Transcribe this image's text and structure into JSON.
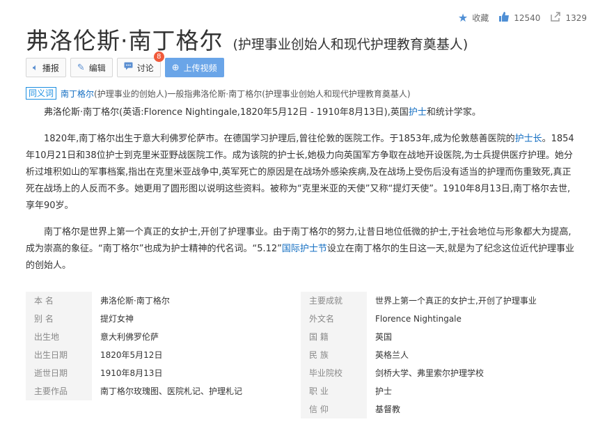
{
  "actions": {
    "favorite_label": "收藏",
    "like_count": "12540",
    "share_count": "1329"
  },
  "title": "弗洛伦斯·南丁格尔",
  "subtitle": "(护理事业创始人和现代护理教育奠基人)",
  "toolbar": {
    "broadcast": "播报",
    "edit": "编辑",
    "discuss": "讨论",
    "discuss_badge": "8",
    "upload": "上传视频"
  },
  "synonym": {
    "tag": "同义词",
    "link": "南丁格尔",
    "text": "(护理事业的创始人)一般指弗洛伦斯·南丁格尔(护理事业创始人和现代护理教育奠基人)"
  },
  "paragraphs": {
    "p1_a": "弗洛伦斯·南丁格尔(英语:Florence Nightingale,1820年5月12日 - 1910年8月13日),英国",
    "p1_link": "护士",
    "p1_b": "和统计学家。",
    "p2_a": "1820年,南丁格尔出生于意大利佛罗伦萨市。在德国学习护理后,曾往伦敦的医院工作。于1853年,成为伦敦慈善医院的",
    "p2_link": "护士长",
    "p2_b": "。1854年10月21日和38位护士到克里米亚野战医院工作。成为该院的护士长,她极力向英国军方争取在战地开设医院,为士兵提供医疗护理。她分析过堆积如山的军事档案,指出在克里米亚战争中,英军死亡的原因是在战场外感染疾病,及在战场上受伤后没有适当的护理而伤重致死,真正死在战场上的人反而不多。她更用了圆形图以说明这些资料。被称为“克里米亚的天使”又称“提灯天使”。1910年8月13日,南丁格尔去世,享年90岁。",
    "p3_a": "南丁格尔是世界上第一个真正的女护士,开创了护理事业。由于南丁格尔的努力,让昔日地位低微的护士,于社会地位与形象都大为提高,成为崇高的象征。“南丁格尔”也成为护士精神的代名词。“5.12”",
    "p3_link": "国际护士节",
    "p3_b": "设立在南丁格尔的生日这一天,就是为了纪念这位近代护理事业的创始人。"
  },
  "info": {
    "left": [
      {
        "label": "本 名",
        "value": "弗洛伦斯·南丁格尔"
      },
      {
        "label": "别 名",
        "value": "提灯女神"
      },
      {
        "label": "出生地",
        "value": "意大利佛罗伦萨"
      },
      {
        "label": "出生日期",
        "value": "1820年5月12日"
      },
      {
        "label": "逝世日期",
        "value": "1910年8月13日"
      },
      {
        "label": "主要作品",
        "value": "南丁格尔玫瑰图、医院札记、护理札记"
      },
      {
        "label": "",
        "value": ""
      }
    ],
    "right": [
      {
        "label": "主要成就",
        "value": "世界上第一个真正的女护士,开创了护理事业"
      },
      {
        "label": "外文名",
        "value": "Florence Nightingale"
      },
      {
        "label": "国 籍",
        "value": "英国"
      },
      {
        "label": "民 族",
        "value": "英格兰人"
      },
      {
        "label": "毕业院校",
        "value": "剑桥大学、弗里索尔护理学校"
      },
      {
        "label": "职 业",
        "value": "护士"
      },
      {
        "label": "信 仰",
        "value": "基督教"
      }
    ]
  },
  "colors": {
    "link": "#136ec2",
    "accent": "#6aa5e8",
    "badge": "#f0593a"
  }
}
